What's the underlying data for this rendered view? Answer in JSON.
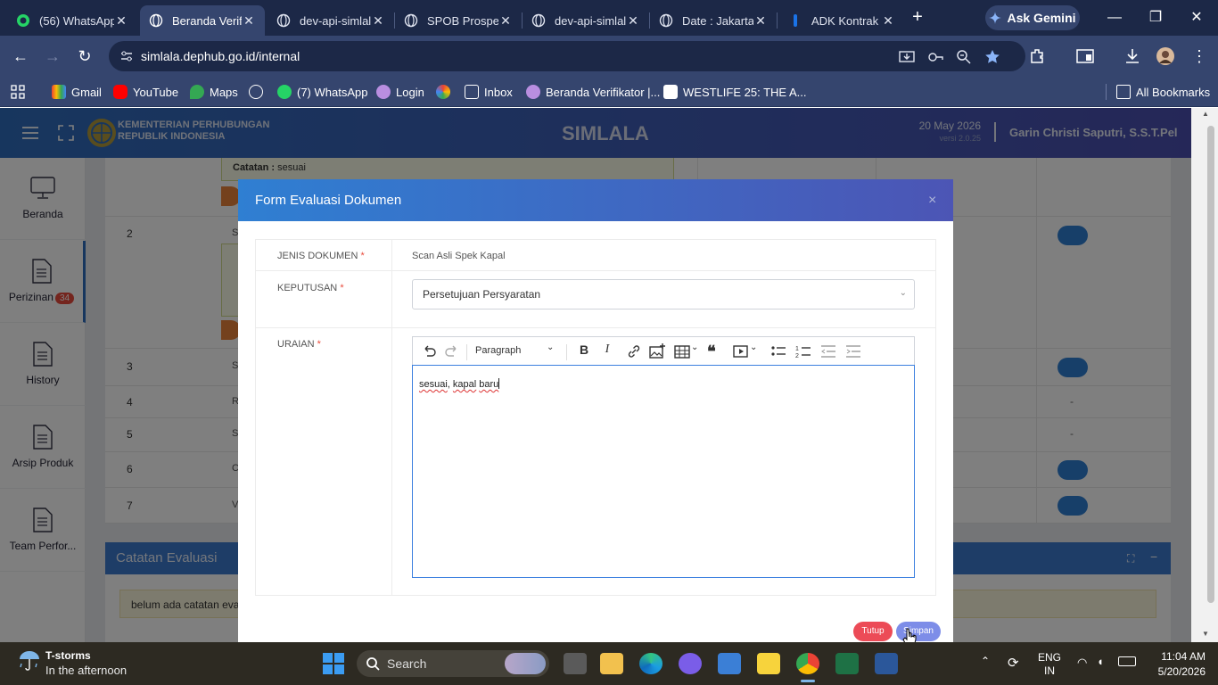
{
  "browser": {
    "tabs": [
      {
        "title": "(56) WhatsApp",
        "active": false
      },
      {
        "title": "Beranda Verifikator",
        "active": true
      },
      {
        "title": "dev-api-simlala",
        "active": false
      },
      {
        "title": "SPOB Prosperity",
        "active": false
      },
      {
        "title": "dev-api-simlala",
        "active": false
      },
      {
        "title": "Date : Jakarta",
        "active": false
      },
      {
        "title": "ADK Kontrak",
        "active": false
      }
    ],
    "gemini_label": "Ask Gemini",
    "url": "simlala.dephub.go.id/internal",
    "bookmarks": [
      "Gmail",
      "YouTube",
      "Maps",
      "(7) WhatsApp",
      "Login",
      "Inbox",
      "Beranda Verifikator |...",
      "WESTLIFE 25: THE A..."
    ],
    "all_bookmarks": "All Bookmarks"
  },
  "header": {
    "logo_line1": "KEMENTERIAN PERHUBUNGAN",
    "logo_line2": "REPUBLIK INDONESIA",
    "brand": "SIMLALA",
    "date": "20 May 2026",
    "version": "versi 2.0.25",
    "user": "Garin Christi Saputri, S.S.T.Pel"
  },
  "sidebar": {
    "items": [
      {
        "label": "Beranda"
      },
      {
        "label": "Perizinan",
        "badge": "34"
      },
      {
        "label": "History"
      },
      {
        "label": "Arsip Produk"
      },
      {
        "label": "Team Perfor..."
      }
    ]
  },
  "background": {
    "note_label": "Catatan :",
    "note_value": "sesuai",
    "rows": [
      {
        "no": "2",
        "text": "Scan"
      },
      {
        "no": "3",
        "text": "Scan"
      },
      {
        "no": "4",
        "text": "RPK"
      },
      {
        "no": "5",
        "text": "Sura"
      },
      {
        "no": "6",
        "text": "Crew"
      },
      {
        "no": "7",
        "text": "Voya"
      }
    ],
    "dash": "-",
    "eval_title": "Catatan Evaluasi",
    "eval_note": "belum ada catatan evaluasi"
  },
  "modal": {
    "title": "Form Evaluasi Dokumen",
    "close": "×",
    "fields": {
      "jenis_label": "JENIS DOKUMEN",
      "jenis_value": "Scan Asli Spek Kapal",
      "keputusan_label": "KEPUTUSAN",
      "keputusan_value": "Persetujuan Persyaratan",
      "uraian_label": "URAIAN",
      "required_mark": "*"
    },
    "editor": {
      "paragraph_style": "Paragraph",
      "content_word1": "sesuai",
      "content_sep": ", ",
      "content_word2": "kapal",
      "content_space": " ",
      "content_word3": "baru"
    },
    "buttons": {
      "tutup": "Tutup",
      "simpan": "Simpan"
    }
  },
  "taskbar": {
    "weather_title": "T-storms",
    "weather_sub": "In the afternoon",
    "search_placeholder": "Search",
    "lang1": "ENG",
    "lang2": "IN",
    "time": "11:04 AM",
    "date": "5/20/2026"
  }
}
